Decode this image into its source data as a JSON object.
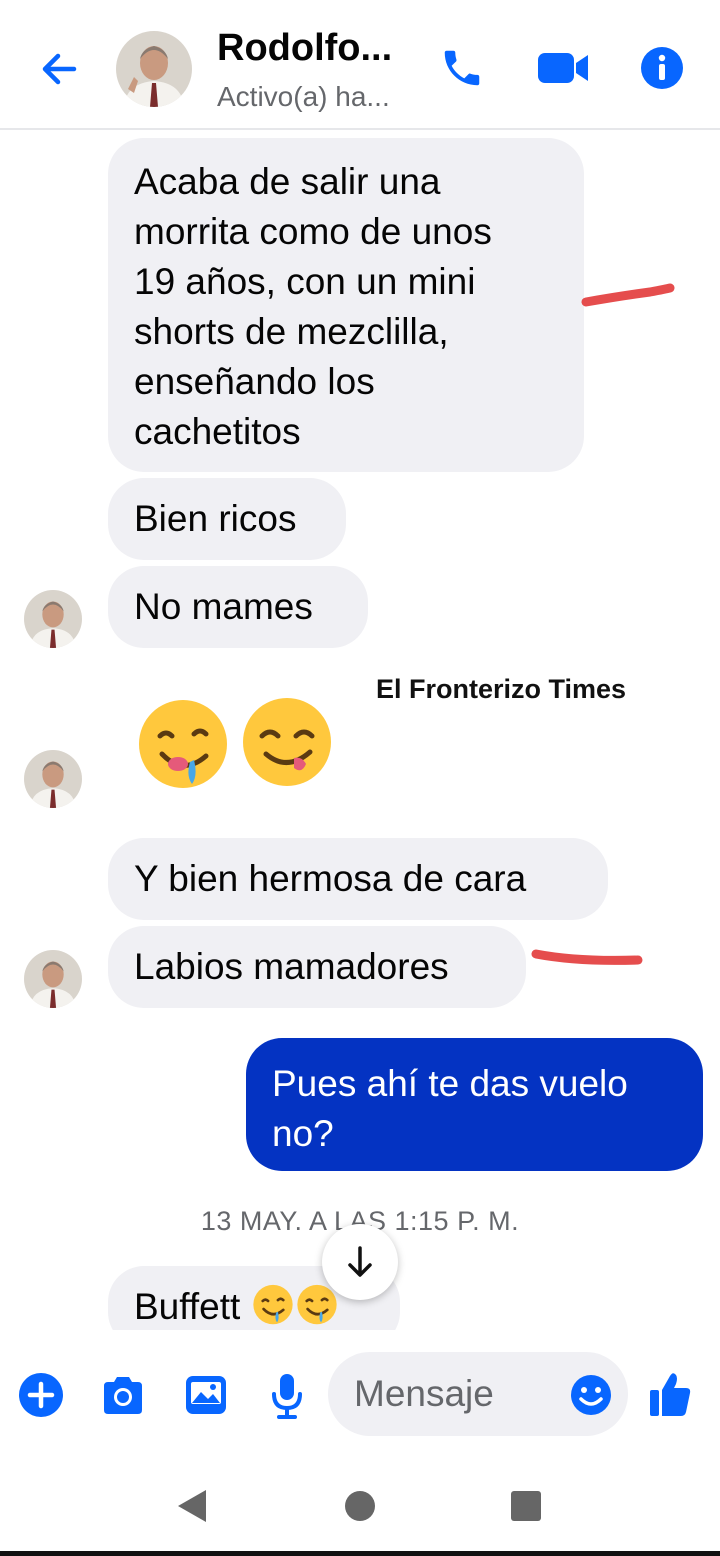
{
  "header": {
    "contact_name": "Rodolfo...",
    "status": "Activo(a) ha..."
  },
  "messages": [
    {
      "lines": [
        "Acaba de salir una",
        "morrita como de unos",
        "19 años, con un mini",
        "shorts de mezclilla,",
        "enseñando los",
        "cachetitos"
      ]
    },
    {
      "text": "Bien ricos"
    },
    {
      "text": "No mames"
    },
    {
      "emoji": [
        "🤤",
        "😋"
      ]
    },
    {
      "text": "Y bien hermosa de cara"
    },
    {
      "text": "Labios mamadores"
    },
    {
      "lines": [
        "Pues ahí te das vuelo",
        "no?"
      ]
    },
    {
      "text": "Buffett",
      "emoji": [
        "🤤",
        "🤤"
      ]
    }
  ],
  "watermark": "El Fronterizo Times",
  "timestamp": "13 MAY. A LAS 1:15 P. M.",
  "composer": {
    "placeholder": "Mensaje"
  },
  "colors": {
    "accent": "#0866ff",
    "outgoing_bubble": "#0433c2",
    "incoming_bubble": "#f0f0f4",
    "annotation_red": "#e23a3a"
  },
  "icons": {
    "header": [
      "back-arrow-icon",
      "phone-icon",
      "video-camera-icon",
      "info-icon"
    ],
    "composer": [
      "plus-icon",
      "camera-icon",
      "gallery-icon",
      "microphone-icon",
      "emoji-icon",
      "thumbs-up-icon"
    ],
    "navigation": [
      "nav-back-icon",
      "nav-home-icon",
      "nav-recents-icon"
    ],
    "scroll": "arrow-down-icon"
  }
}
